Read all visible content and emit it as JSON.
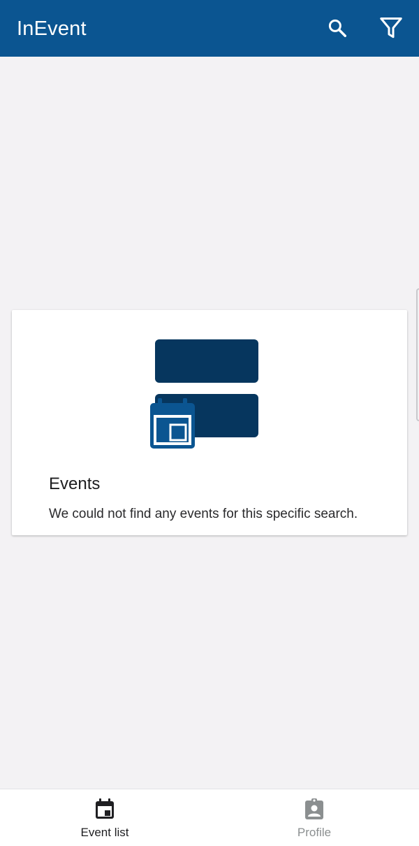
{
  "app_bar": {
    "title": "InEvent",
    "actions": [
      {
        "name": "search",
        "icon": "search-icon"
      },
      {
        "name": "filter",
        "icon": "filter-icon"
      }
    ],
    "background_color": "#0b5591"
  },
  "empty_state": {
    "illustration": "events-calendar-illustration",
    "title": "Events",
    "message": "We could not find any events for this specific search."
  },
  "bottom_nav": {
    "items": [
      {
        "label": "Event list",
        "icon": "calendar-icon",
        "active": true
      },
      {
        "label": "Profile",
        "icon": "profile-badge-icon",
        "active": false
      }
    ]
  },
  "colors": {
    "primary": "#0b5591",
    "illustration_dark": "#06365e",
    "background": "#f3f2f4",
    "inactive": "#8b8f90"
  }
}
